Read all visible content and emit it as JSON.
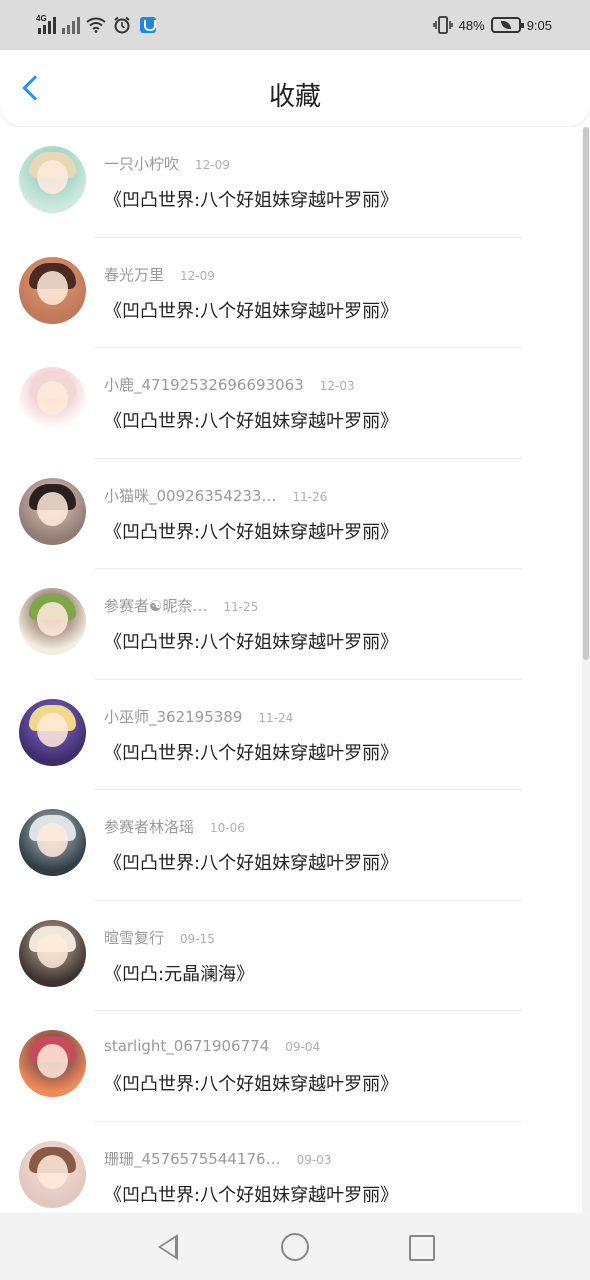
{
  "status_bar": {
    "network_type": "4G",
    "battery_level": "48%",
    "time": "9:05",
    "icons": [
      "signal-icon",
      "signal-off-icon",
      "wifi-icon",
      "alarm-icon",
      "shield-app-icon",
      "vibrate-icon",
      "battery-icon"
    ]
  },
  "header": {
    "title": "收藏",
    "back_icon": "chevron-left-icon",
    "accent_color": "#2196f3"
  },
  "favorites": [
    {
      "user": "一只小柠吹",
      "date": "12-09",
      "work": "《凹凸世界:八个好姐妹穿越叶罗丽》",
      "avatar_colors": [
        "#cfe9df",
        "#e9d8b5",
        "#7fc7b5"
      ]
    },
    {
      "user": "春光万里",
      "date": "12-09",
      "work": "《凹凸世界:八个好姐妹穿越叶罗丽》",
      "avatar_colors": [
        "#c0785a",
        "#4a2a22",
        "#e39a6b"
      ]
    },
    {
      "user": "小鹿_471925326966930​63",
      "date": "12-03",
      "work": "《凹凸世界:八个好姐妹穿越叶罗丽》",
      "avatar_colors": [
        "#ffffff",
        "#f3d6d6",
        "#e7a9b0"
      ]
    },
    {
      "user": "小猫咪_00926354233…",
      "date": "11-26",
      "work": "《凹凸世界:八个好姐妹穿越叶罗丽》",
      "avatar_colors": [
        "#8f7b74",
        "#2b2020",
        "#e8c9bd"
      ]
    },
    {
      "user": "参赛者☯昵奈…",
      "date": "11-25",
      "work": "《凹凸世界:八个好姐妹穿越叶罗丽》",
      "avatar_colors": [
        "#f2eedf",
        "#7fa64a",
        "#6b3a35"
      ]
    },
    {
      "user": "小巫师_362195389",
      "date": "11-24",
      "work": "《凹凸世界:八个好姐妹穿越叶罗丽》",
      "avatar_colors": [
        "#3d2d6b",
        "#f0d98a",
        "#8a6bd1"
      ]
    },
    {
      "user": "参赛者林洛瑶",
      "date": "10-06",
      "work": "《凹凸世界:八个好姐妹穿越叶罗丽》",
      "avatar_colors": [
        "#2f3c44",
        "#dfe3e6",
        "#b8c3c9"
      ]
    },
    {
      "user": "暄雪复行",
      "date": "09-15",
      "work": "《凹凸:元晶澜海》",
      "avatar_colors": [
        "#3c3230",
        "#efe8dc",
        "#c8b69a"
      ]
    },
    {
      "user": "starlight_0671906774",
      "date": "09-04",
      "work": "《凹凸世界:八个好姐妹穿越叶罗丽》",
      "avatar_colors": [
        "#f08a5a",
        "#c64b5b",
        "#3a2b3f"
      ]
    },
    {
      "user": "珊珊_4576575544176…",
      "date": "09-03",
      "work": "《凹凸世界:八个好姐妹穿越叶罗丽》",
      "avatar_colors": [
        "#e2c7bf",
        "#8a5a44",
        "#f3e0d6"
      ]
    }
  ],
  "nav_bar": {
    "icons": [
      "nav-back-icon",
      "nav-home-icon",
      "nav-recent-icon"
    ]
  }
}
